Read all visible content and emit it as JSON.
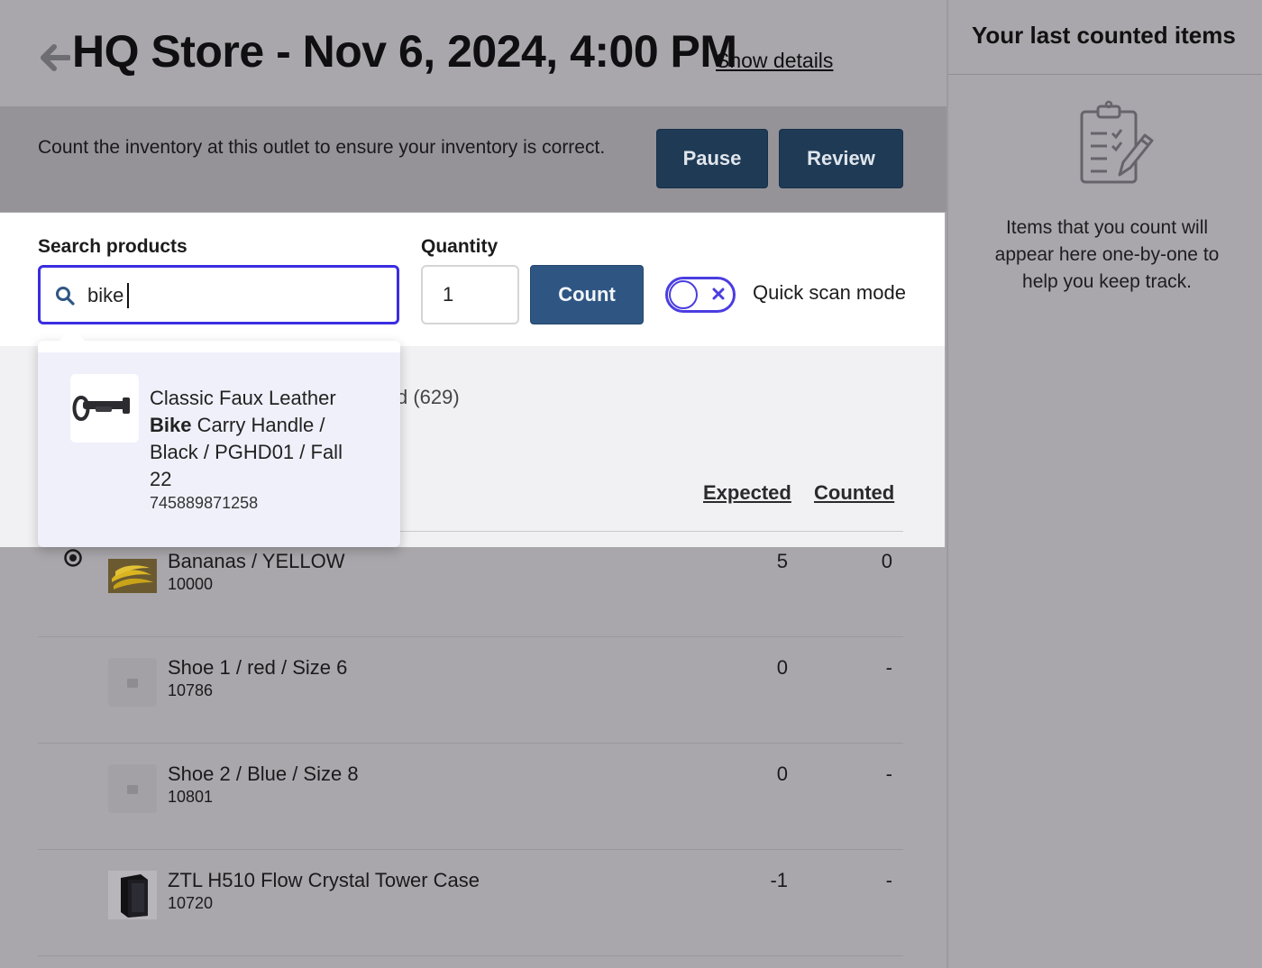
{
  "header": {
    "title": "HQ Store - Nov 6, 2024, 4:00 PM",
    "show_details_label": "Show details"
  },
  "banner": {
    "text": "Count the inventory at this outlet to ensure your inventory is correct.",
    "pause_label": "Pause",
    "review_label": "Review"
  },
  "search": {
    "label": "Search products",
    "value": "bike",
    "quantity_label": "Quantity",
    "quantity_value": "1",
    "count_label": "Count",
    "quick_scan_label": "Quick scan mode",
    "quick_scan_on": false
  },
  "dropdown": {
    "result": {
      "name_before": "Classic Faux Leather ",
      "name_match": "Bike",
      "name_after": " Carry Handle / Black / PGHD01 / Fall 22",
      "sku": "745889871258",
      "thumb_icon": "bike-handle-image"
    }
  },
  "list": {
    "partial_tab_text": "d (629)",
    "col_expected": "Expected",
    "col_counted": "Counted",
    "rows": [
      {
        "name": "Bananas / YELLOW",
        "sku": "10000",
        "expected": "5",
        "counted": "0",
        "thumb": "bananas-image",
        "selected": true
      },
      {
        "name": "Shoe 1 / red / Size 6",
        "sku": "10786",
        "expected": "0",
        "counted": "-",
        "thumb": "placeholder-image"
      },
      {
        "name": "Shoe 2 / Blue / Size 8",
        "sku": "10801",
        "expected": "0",
        "counted": "-",
        "thumb": "placeholder-image"
      },
      {
        "name": "ZTL H510 Flow Crystal Tower Case",
        "sku": "10720",
        "expected": "-1",
        "counted": "-",
        "thumb": "tower-case-image"
      }
    ]
  },
  "sidebar": {
    "title": "Your last counted items",
    "message": "Items that you count will appear here one-by-one to help you keep track.",
    "icon": "clipboard-icon"
  },
  "colors": {
    "primary_dark": "#1f3a55",
    "primary": "#2f5683",
    "focus": "#3a2de0",
    "overlay": "#a9a7ab"
  }
}
